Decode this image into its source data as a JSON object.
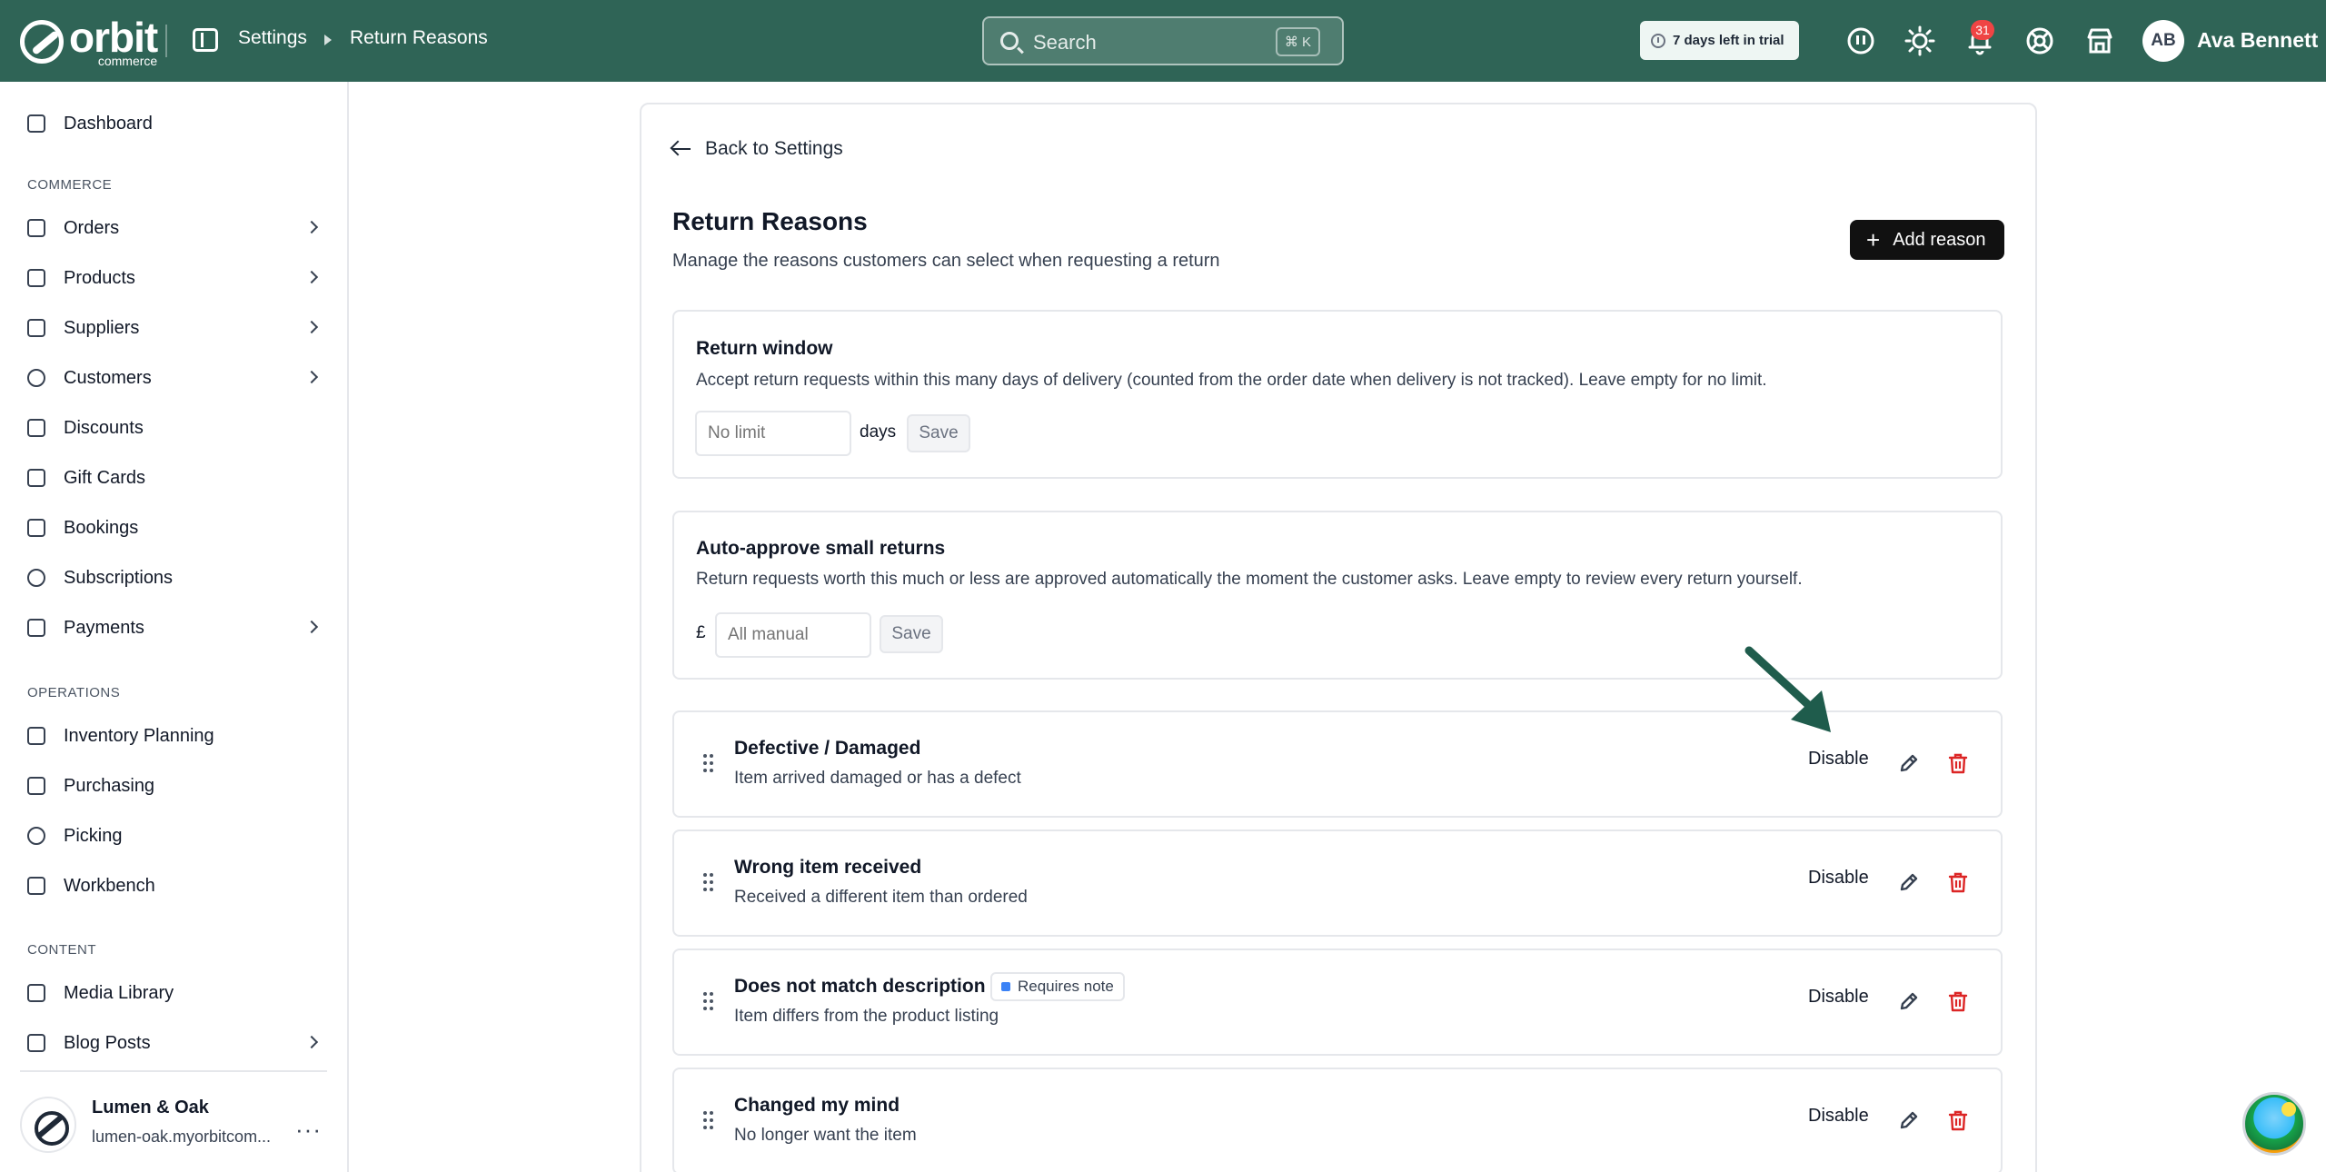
{
  "topbar": {
    "logo_word": "orbit",
    "logo_sub": "commerce",
    "breadcrumb": [
      "Settings",
      "Return Reasons"
    ],
    "search_placeholder": "Search",
    "search_shortcut": "⌘ K",
    "trial_text": "7 days left in trial",
    "notification_count": "31",
    "avatar_initials": "AB",
    "user_name": "Ava Bennett"
  },
  "sidebar": {
    "dashboard": "Dashboard",
    "sections": {
      "commerce": "COMMERCE",
      "operations": "OPERATIONS",
      "content": "CONTENT"
    },
    "commerce_items": [
      "Orders",
      "Products",
      "Suppliers",
      "Customers",
      "Discounts",
      "Gift Cards",
      "Bookings",
      "Subscriptions",
      "Payments"
    ],
    "operations_items": [
      "Inventory Planning",
      "Purchasing",
      "Picking",
      "Workbench"
    ],
    "content_items": [
      "Media Library",
      "Blog Posts"
    ],
    "store": {
      "name": "Lumen & Oak",
      "url": "lumen-oak.myorbitcom..."
    }
  },
  "main": {
    "back_link": "Back to Settings",
    "title": "Return Reasons",
    "subtitle": "Manage the reasons customers can select when requesting a return",
    "add_button": "Add reason",
    "return_window": {
      "title": "Return window",
      "description": "Accept return requests within this many days of delivery (counted from the order date when delivery is not tracked). Leave empty for no limit.",
      "placeholder": "No limit",
      "unit": "days",
      "save": "Save"
    },
    "auto_approve": {
      "title": "Auto-approve small returns",
      "description": "Return requests worth this much or less are approved automatically the moment the customer asks. Leave empty to review every return yourself.",
      "currency": "£",
      "placeholder": "All manual",
      "save": "Save"
    },
    "reasons": [
      {
        "title": "Defective / Damaged",
        "description": "Item arrived damaged or has a defect",
        "action": "Disable"
      },
      {
        "title": "Wrong item received",
        "description": "Received a different item than ordered",
        "action": "Disable"
      },
      {
        "title": "Does not match description",
        "description": "Item differs from the product listing",
        "action": "Disable",
        "badge": "Requires note"
      },
      {
        "title": "Changed my mind",
        "description": "No longer want the item",
        "action": "Disable"
      }
    ]
  },
  "colors": {
    "topbar": "#2f6456",
    "accent_arrow": "#1f5c4c",
    "danger": "#dc2626",
    "badge_dot": "#3b82f6"
  }
}
